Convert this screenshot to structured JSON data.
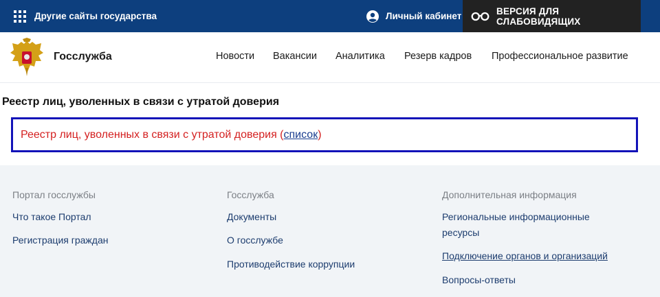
{
  "topbar": {
    "other_sites_label": "Другие сайты государства",
    "cabinet_label": "Личный кабинет",
    "accessibility_label": "ВЕРСИЯ ДЛЯ СЛАБОВИДЯЩИХ",
    "background_color": "#0d3f7e"
  },
  "header": {
    "brand": "Госслужба",
    "nav": [
      "Новости",
      "Вакансии",
      "Аналитика",
      "Резерв кадров",
      "Профессиональное развитие"
    ]
  },
  "main": {
    "page_title": "Реестр лиц, уволенных в связи с утратой доверия",
    "registry_text": "Реестр лиц, уволенных в связи с утратой доверия (",
    "registry_link": "список",
    "registry_close": ")"
  },
  "footer": {
    "col1": {
      "heading": "Портал госслужбы",
      "links": [
        "Что такое Портал",
        "Регистрация граждан"
      ]
    },
    "col2": {
      "heading": "Госслужба",
      "links": [
        "Документы",
        "О госслужбе",
        "Противодействие коррупции"
      ]
    },
    "col3": {
      "heading": "Дополнительная информация",
      "links": [
        "Региональные информационные",
        "ресурсы",
        "Подключение органов и организаций",
        "Вопросы-ответы"
      ]
    }
  }
}
